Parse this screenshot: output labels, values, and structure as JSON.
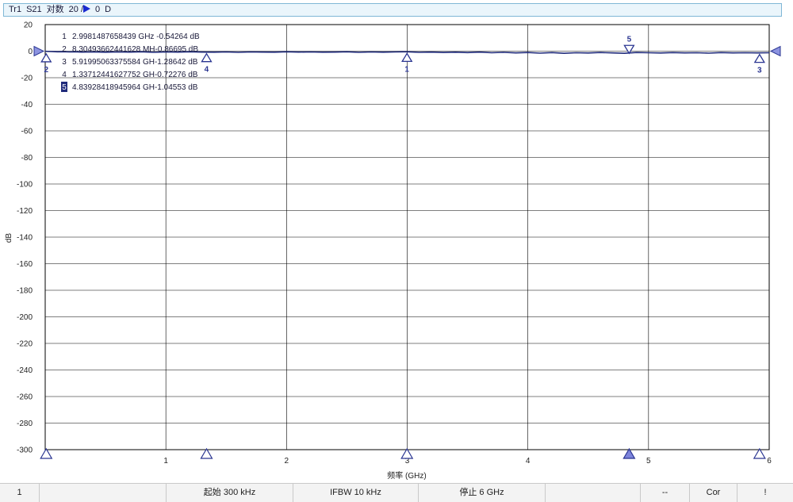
{
  "header": {
    "trace": "Tr1",
    "param": "S21",
    "format": "对数",
    "scale": "20 /",
    "ref_value": "0",
    "ref_unit": "D"
  },
  "chart_data": {
    "type": "line",
    "xlabel": "频率 (GHz)",
    "ylabel": "dB",
    "xlim": [
      0,
      6
    ],
    "ylim": [
      -300,
      20
    ],
    "x_ticks": [
      1,
      2,
      3,
      4,
      5,
      6
    ],
    "y_ticks": [
      20,
      0,
      -20,
      -40,
      -60,
      -80,
      -100,
      -120,
      -140,
      -160,
      -180,
      -200,
      -220,
      -240,
      -260,
      -280,
      -300
    ],
    "grid": true,
    "series": [
      {
        "x": [
          0.0003,
          0.05,
          0.1,
          0.15,
          0.2,
          0.25,
          0.3,
          0.4,
          0.5,
          0.6,
          0.7,
          0.8,
          0.9,
          1.0,
          1.1,
          1.2,
          1.3,
          1.4,
          1.5,
          1.6,
          1.7,
          1.8,
          1.9,
          2.0,
          2.1,
          2.2,
          2.3,
          2.4,
          2.5,
          2.6,
          2.7,
          2.8,
          2.9,
          3.0,
          3.1,
          3.2,
          3.3,
          3.4,
          3.5,
          3.6,
          3.7,
          3.8,
          3.9,
          4.0,
          4.1,
          4.2,
          4.3,
          4.4,
          4.5,
          4.6,
          4.7,
          4.8,
          4.9,
          5.0,
          5.1,
          5.2,
          5.3,
          5.4,
          5.5,
          5.6,
          5.7,
          5.8,
          5.9,
          6.0
        ],
        "y": [
          -0.1,
          -0.3,
          -0.5,
          -0.4,
          -0.6,
          -0.5,
          -0.7,
          -0.6,
          -0.8,
          -0.6,
          -0.7,
          -0.5,
          -0.9,
          -0.6,
          -0.7,
          -0.5,
          -0.7,
          -0.8,
          -0.6,
          -0.9,
          -0.6,
          -0.7,
          -0.8,
          -0.5,
          -0.7,
          -0.6,
          -0.8,
          -0.7,
          -0.5,
          -0.9,
          -0.6,
          -0.8,
          -0.6,
          -0.5,
          -0.9,
          -0.7,
          -1.0,
          -0.8,
          -1.1,
          -0.7,
          -1.2,
          -0.9,
          -1.3,
          -1.0,
          -1.5,
          -1.1,
          -1.6,
          -1.2,
          -1.4,
          -1.0,
          -1.3,
          -1.6,
          -1.0,
          -1.2,
          -1.4,
          -1.1,
          -1.3,
          -1.2,
          -1.5,
          -1.1,
          -1.3,
          -1.2,
          -1.3,
          -1.2
        ]
      }
    ],
    "markers": [
      {
        "id": "1",
        "x": 2.9981487658439,
        "y": -0.54264,
        "readout": "2.9981487658439 GHz -0.54264 dB"
      },
      {
        "id": "2",
        "x": 0.0083049366244163,
        "y": -0.86695,
        "readout": "8.30493662441628 MH-0.86695 dB"
      },
      {
        "id": "3",
        "x": 5.91995063375584,
        "y": -1.28642,
        "readout": "5.91995063375584 GH-1.28642 dB"
      },
      {
        "id": "4",
        "x": 1.33712441627752,
        "y": -0.72276,
        "readout": "1.33712441627752 GH-0.72276 dB"
      },
      {
        "id": "5",
        "x": 4.83928418945964,
        "y": -1.04553,
        "readout": "4.83928418945964 GH-1.04553 dB",
        "active": true
      }
    ],
    "ref_level": 0
  },
  "colors": {
    "trace": "#1f2a7a",
    "marker": "#2a3591",
    "marker_fill": "#a9aee8",
    "grid": "#000000",
    "header_border": "#7fb7d6"
  },
  "status_bar": {
    "channel": "1",
    "start": "起始 300 kHz",
    "ifbw": "IFBW 10 kHz",
    "stop": "停止 6 GHz",
    "dashes": "--",
    "cor": "Cor",
    "warn": "!"
  }
}
